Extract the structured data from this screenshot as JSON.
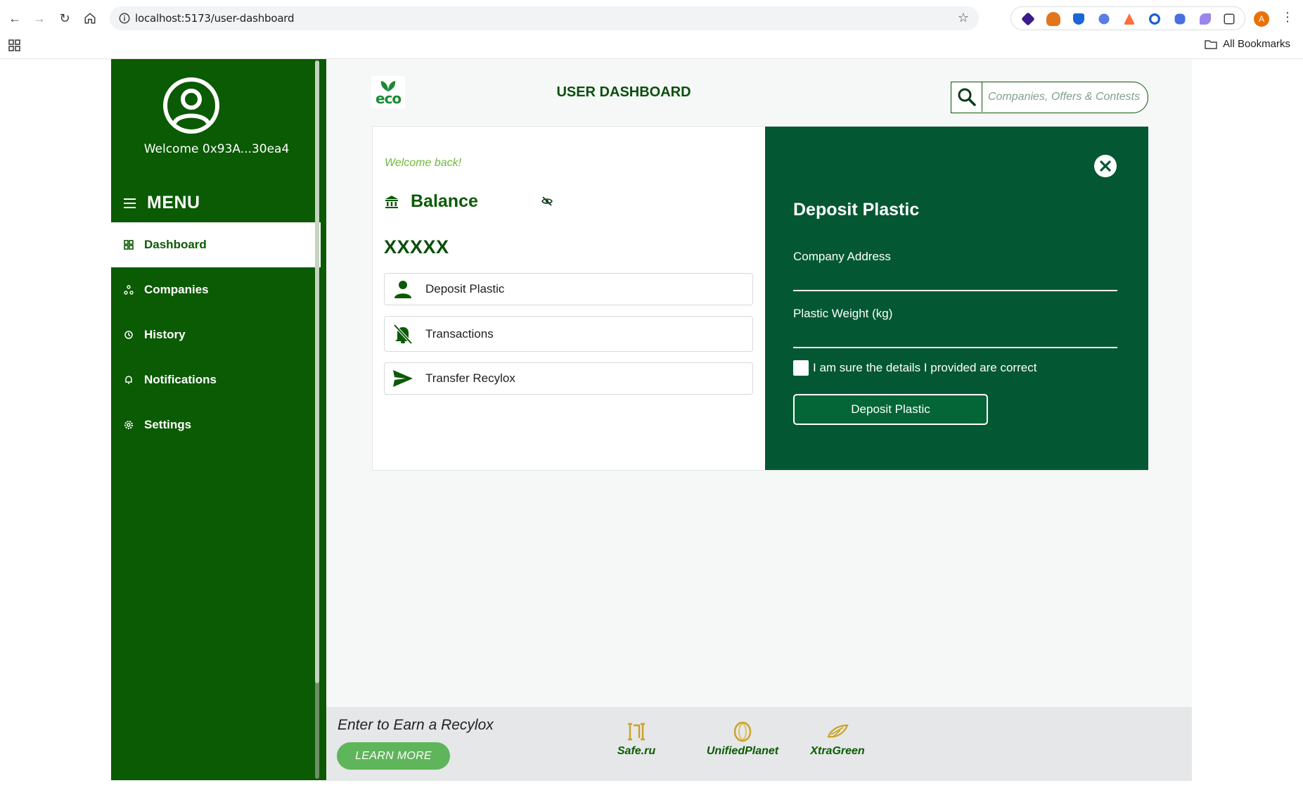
{
  "browser": {
    "url": "localhost:5173/user-dashboard",
    "bookmarks_label": "All Bookmarks",
    "profile_initial": "A"
  },
  "sidebar": {
    "welcome": "Welcome 0x93A...30ea4",
    "menu_title": "MENU",
    "items": [
      {
        "label": "Dashboard",
        "icon": "grid-icon",
        "active": true
      },
      {
        "label": "Companies",
        "icon": "network-icon",
        "active": false
      },
      {
        "label": "History",
        "icon": "history-icon",
        "active": false
      },
      {
        "label": "Notifications",
        "icon": "bell-icon",
        "active": false
      },
      {
        "label": "Settings",
        "icon": "gear-icon",
        "active": false
      }
    ]
  },
  "header": {
    "logo_text": "eco",
    "title": "USER DASHBOARD",
    "search_placeholder": "Companies, Offers & Contests"
  },
  "balance": {
    "welcome": "Welcome back!",
    "label": "Balance",
    "value": "XXXXX"
  },
  "actions": [
    {
      "label": "Deposit Plastic",
      "icon": "person-icon"
    },
    {
      "label": "Transactions",
      "icon": "bell-off-icon"
    },
    {
      "label": "Transfer Recylox",
      "icon": "send-icon"
    }
  ],
  "deposit_form": {
    "title": "Deposit Plastic",
    "company_address_label": "Company Address",
    "company_address_value": "",
    "weight_label": "Plastic Weight (kg)",
    "weight_value": "",
    "confirm_label": "I am sure the details I provided are correct",
    "submit_label": "Deposit Plastic"
  },
  "footer": {
    "earn_text": "Enter to Earn a Recylox",
    "learn_more": "LEARN MORE",
    "partners": [
      "Safe.ru",
      "UnifiedPlanet",
      "XtraGreen"
    ]
  },
  "colors": {
    "sidebar": "#0b5a04",
    "panel": "#035833",
    "accent": "#5fb55a"
  }
}
